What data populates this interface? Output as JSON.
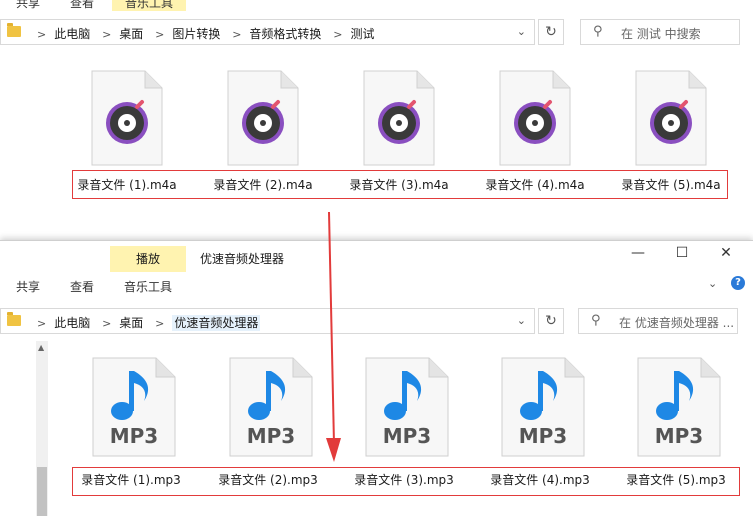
{
  "window1": {
    "ribbon_tabs": [
      "共享",
      "查看",
      "音乐工具"
    ],
    "breadcrumb": [
      "此电脑",
      "桌面",
      "图片转换",
      "音频格式转换",
      "测试"
    ],
    "search_placeholder": "在 测试 中搜索",
    "files": [
      "录音文件 (1).m4a",
      "录音文件 (2).m4a",
      "录音文件 (3).m4a",
      "录音文件 (4).m4a",
      "录音文件 (5).m4a"
    ],
    "file_icon": "audio-disc-icon"
  },
  "window2": {
    "title": "优速音频处理器",
    "context_tab": "播放",
    "ribbon_tabs": [
      "共享",
      "查看",
      "音乐工具"
    ],
    "controls": {
      "minimize": "—",
      "maximize": "☐",
      "close": "✕"
    },
    "breadcrumb": [
      "此电脑",
      "桌面",
      "优速音频处理器"
    ],
    "search_placeholder": "在 优速音频处理器 ...",
    "files": [
      "录音文件 (1).mp3",
      "录音文件 (2).mp3",
      "录音文件 (3).mp3",
      "录音文件 (4).mp3",
      "录音文件 (5).mp3"
    ],
    "file_icon": "music-note-icon",
    "file_badge": "MP3",
    "help": "?"
  },
  "colors": {
    "highlight_red": "#e23b3b",
    "context_tab_bg": "#fff3b0",
    "note_blue": "#1e88e5"
  }
}
